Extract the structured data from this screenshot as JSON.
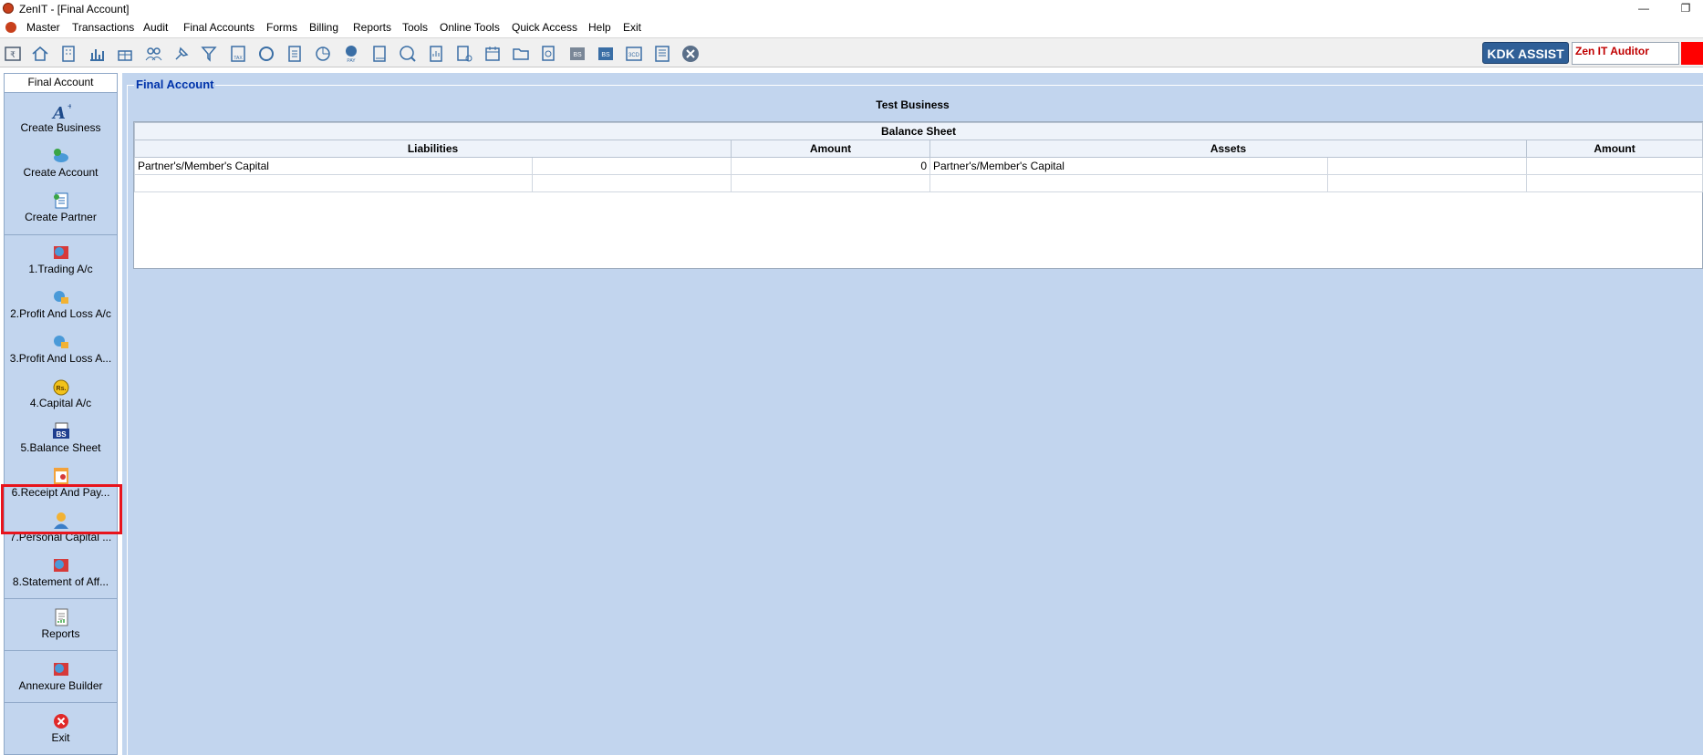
{
  "window": {
    "title": "ZenIT - [Final Account]"
  },
  "menu": [
    "Master",
    "Transactions",
    "Audit",
    "Final Accounts",
    "Forms",
    "Billing",
    "Reports",
    "Tools",
    "Online Tools",
    "Quick Access",
    "Help",
    "Exit"
  ],
  "toolbar": {
    "assist_label": "KDK ASSIST",
    "auditor_label": "Zen IT Auditor"
  },
  "sidebar": {
    "header": "Final Account",
    "items": [
      {
        "label": "Create Business",
        "icon": "create-business-icon"
      },
      {
        "label": "Create Account",
        "icon": "create-account-icon"
      },
      {
        "label": "Create Partner",
        "icon": "create-partner-icon"
      },
      {
        "label": "1.Trading A/c",
        "icon": "trading-icon"
      },
      {
        "label": "2.Profit And Loss A/c",
        "icon": "profit-loss-icon"
      },
      {
        "label": "3.Profit And Loss A...",
        "icon": "profit-loss-appropriation-icon"
      },
      {
        "label": "4.Capital A/c",
        "icon": "money-bag-icon"
      },
      {
        "label": "5.Balance Sheet",
        "icon": "balance-sheet-icon"
      },
      {
        "label": "6.Receipt And Pay...",
        "icon": "receipt-payment-icon"
      },
      {
        "label": "7.Personal Capital ...",
        "icon": "person-icon"
      },
      {
        "label": "8.Statement of Aff...",
        "icon": "statement-icon"
      },
      {
        "label": "Reports",
        "icon": "reports-icon"
      },
      {
        "label": "Annexure Builder",
        "icon": "annexure-icon"
      },
      {
        "label": "Exit",
        "icon": "exit-icon"
      }
    ]
  },
  "main": {
    "group_title": "Final Account",
    "business_name": "Test Business",
    "sheet_title": "Balance Sheet",
    "columns": [
      "Liabilities",
      "Amount",
      "Assets",
      "Amount"
    ],
    "rows": [
      {
        "liability": "Partner's/Member's Capital",
        "l_amount": "0",
        "asset": "Partner's/Member's Capital",
        "a_amount": ""
      }
    ]
  },
  "colors": {
    "panel_bg": "#c2d5ee",
    "highlight": "#e8141c",
    "assist_bg": "#2f5f97",
    "auditor_text": "#c00000"
  }
}
